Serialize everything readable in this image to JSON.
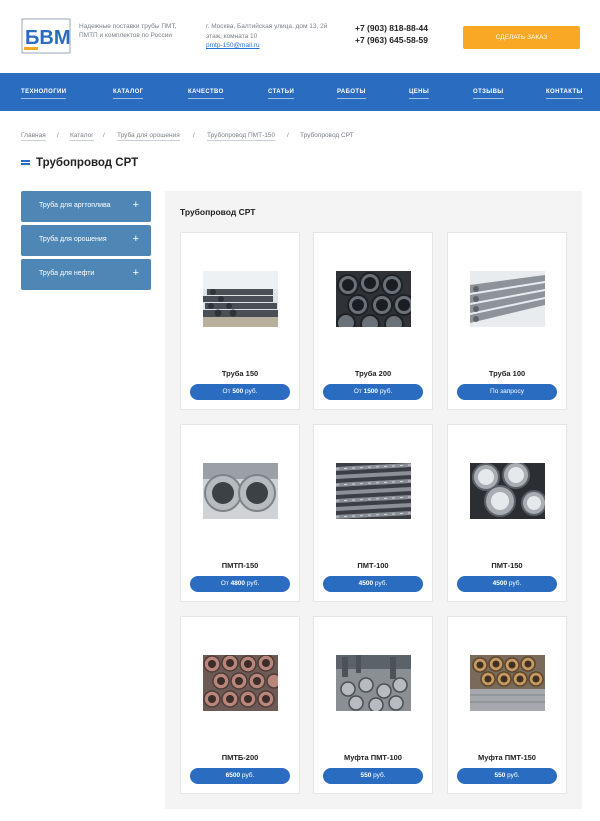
{
  "header": {
    "logo_text": "БВМ",
    "tagline": "Надежные поставки трубы ПМТ, ПМТП и комплектов по России",
    "address": "г. Москва, Балтийская улица, дом 13, 2й этаж, комната 10",
    "email": "pmtp-150@mail.ru",
    "phones": [
      "+7 (903) 818-88-44",
      "+7 (963) 645-58-59"
    ],
    "order_button": "СДЕЛАТЬ ЗАКАЗ"
  },
  "nav": {
    "items": [
      "ТЕХНОЛОГИИ",
      "КАТАЛОГ",
      "КАЧЕСТВО",
      "СТАТЬИ",
      "РАБОТЫ",
      "ЦЕНЫ",
      "ОТЗЫВЫ",
      "КОНТАКТЫ"
    ]
  },
  "breadcrumb": {
    "items": [
      "Главная",
      "Каталог",
      "Труба для орошения",
      "Трубопровод ПМТ-150",
      "Трубопровод СРТ"
    ],
    "separator": "/"
  },
  "page": {
    "title": "Трубопровод СРТ"
  },
  "sidebar": {
    "items": [
      {
        "label": "Труба для аргтоплива",
        "icon": "plus-icon"
      },
      {
        "label": "Труба для орошения",
        "icon": "plus-icon"
      },
      {
        "label": "Труба для нефти",
        "icon": "plus-icon"
      }
    ],
    "expand_glyph": "+"
  },
  "catalog": {
    "title": "Трубопровод СРТ",
    "products": [
      {
        "name": "Труба 150",
        "price_prefix": "От ",
        "price_value": "500",
        "price_suffix": " руб.",
        "photo": "stacked-pipes-yard"
      },
      {
        "name": "Труба 200",
        "price_prefix": "От ",
        "price_value": "1500",
        "price_suffix": " руб.",
        "photo": "pipe-ends-dark"
      },
      {
        "name": "Труба 100",
        "price_prefix": "По запросу",
        "price_value": "",
        "price_suffix": "",
        "photo": "pipe-bundle-long"
      },
      {
        "name": "ПМТП-150",
        "price_prefix": "От ",
        "price_value": "4800",
        "price_suffix": " руб.",
        "photo": "two-large-pipes"
      },
      {
        "name": "ПМТ-100",
        "price_prefix": "",
        "price_value": "4500",
        "price_suffix": " руб.",
        "photo": "pipes-diagonal"
      },
      {
        "name": "ПМТ-150",
        "price_prefix": "",
        "price_value": "4500",
        "price_suffix": " руб.",
        "photo": "pipe-ends-large"
      },
      {
        "name": "ПМТБ-200",
        "price_prefix": "",
        "price_value": "6500",
        "price_suffix": " руб.",
        "photo": "rusty-pipe-ends"
      },
      {
        "name": "Муфта ПМТ-100",
        "price_prefix": "",
        "price_value": "550",
        "price_suffix": " руб.",
        "photo": "couplings-pile"
      },
      {
        "name": "Муфта ПМТ-150",
        "price_prefix": "",
        "price_value": "550",
        "price_suffix": " руб.",
        "photo": "couplings-crate"
      }
    ]
  },
  "colors": {
    "brand_blue": "#2a6cc0",
    "sidebar_blue": "#4e86b5",
    "accent_orange": "#f9a825",
    "panel_gray": "#f4f4f4"
  }
}
